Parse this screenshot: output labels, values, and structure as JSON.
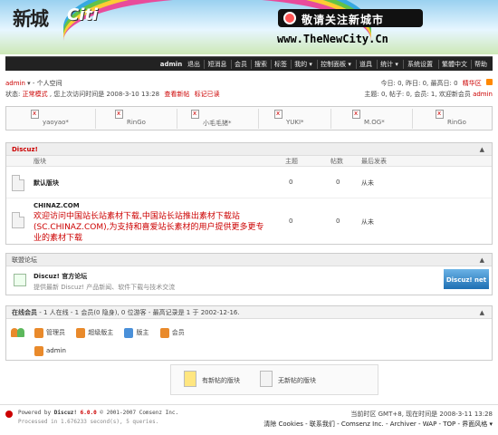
{
  "banner": {
    "logo_text": "新城",
    "logo_sub": "Citi",
    "slogan": "敬请关注新城市",
    "url": "www.TheNewCity.Cn"
  },
  "nav": {
    "items": [
      "admin",
      "退出",
      "短消息",
      "会员",
      "搜索",
      "标签",
      "我的 ▾",
      "控制面板 ▾",
      "道具",
      "统计 ▾",
      "系统设置",
      "繁體中文",
      "帮助"
    ]
  },
  "userbar": {
    "user": "admin",
    "space": "个人空间",
    "status_label": "状态:",
    "status_mode": "正常模式",
    "status_text": ", 您上次访问时间是",
    "last_visit": "2008-3-10 13:28",
    "view_new": "查看新帖",
    "mark_read": "标记已读",
    "stats_right": "今日: 0, 昨日: 0, 最高日: 0",
    "digest": "精华区",
    "topics_right": "主题: 0, 帖子: 0, 会员: 1, 欢迎新会员",
    "new_member": "admin"
  },
  "members": [
    "yaoyao*",
    "RinGo",
    "小毛毛猪*",
    "YUKI*",
    "M.OG*",
    "RinGo"
  ],
  "forum_block": {
    "title": "Discuz!",
    "caret": "▲",
    "headers": {
      "forum": "版块",
      "topics": "主题",
      "posts": "帖数",
      "last": "最后发表"
    },
    "rows": [
      {
        "name": "默认版块",
        "desc": "",
        "topics": "0",
        "posts": "0",
        "last": "从未"
      },
      {
        "name": "CHINAZ.COM",
        "desc": "欢迎访问中国站长站素材下载,中国站长站推出素材下载站(SC.CHINAZ.COM),为支持和喜爱站长素材的用户提供更多更专业的素材下载",
        "topics": "0",
        "posts": "0",
        "last": "从未"
      }
    ]
  },
  "links_block": {
    "title": "联盟论坛",
    "caret": "▲",
    "site_name": "Discuz! 官方论坛",
    "site_desc": "提供最新 Discuz! 产品新闻、软件下载与技术交流",
    "badge": "Discuz! net"
  },
  "online_block": {
    "title": "在线会员",
    "summary": "- 1 人在线 - 1 会员(0 隐身), 0 位游客 - 最高记录是 1 于 2002-12-16.",
    "caret": "▲",
    "legend": [
      "管理员",
      "超级版主",
      "版主",
      "会员"
    ],
    "legend_colors": [
      "#e98a2b",
      "#e98a2b",
      "#4a90d9",
      "#e98a2b"
    ],
    "online_user": "admin"
  },
  "new_legend": {
    "new": "有新帖的版块",
    "none": "无新帖的版块"
  },
  "footer": {
    "powered_pre": "Powered by",
    "product": "Discuz!",
    "version": "6.0.0",
    "copyright": "© 2001-2007 Comsenz Inc.",
    "processed": "Processed in 1.676233 second(s), 5 queries.",
    "tz": "当前时区 GMT+8, 现在时间是 2008-3-11 13:28",
    "links": "清除 Cookies - 联系我们 - Comsenz Inc. - Archiver - WAP - TOP - 界面风格 ▾"
  }
}
